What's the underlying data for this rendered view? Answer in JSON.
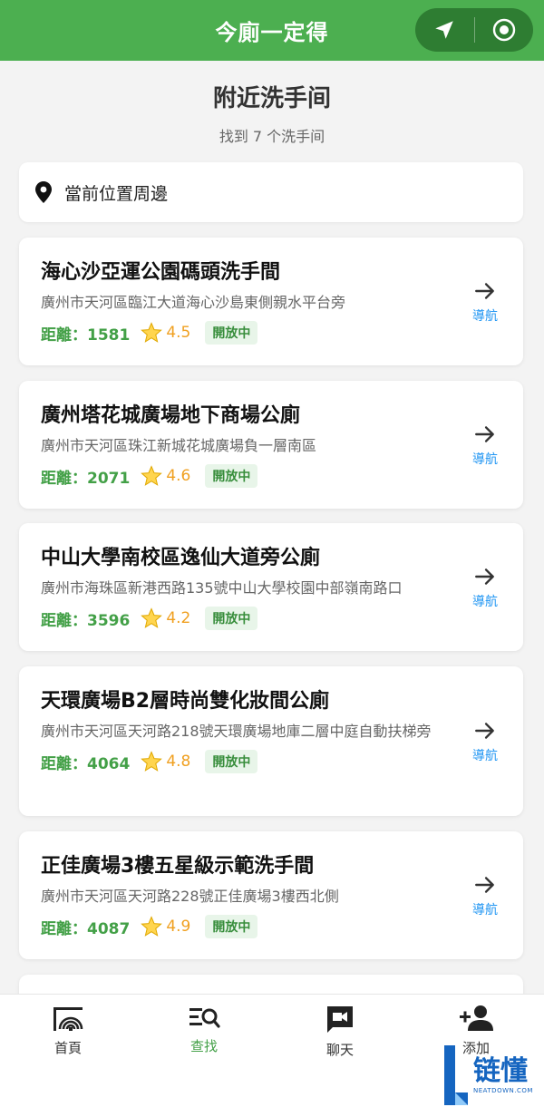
{
  "header": {
    "title": "今廁一定得",
    "capsule_left_icon": "navigation-arrow-icon",
    "capsule_right_icon": "target-circle-icon"
  },
  "page": {
    "title": "附近洗手间",
    "subtitle": "找到 7 个洗手间"
  },
  "location": {
    "icon": "location-pin-icon",
    "label": "當前位置周邊"
  },
  "toilets": [
    {
      "name": "海心沙亞運公園碼頭洗手間",
      "address": "廣州市天河區臨江大道海心沙島東側親水平台旁",
      "distance": "距離：1581",
      "rating": "4.5",
      "status": "開放中",
      "nav_label": "導航"
    },
    {
      "name": "廣州塔花城廣場地下商場公廁",
      "address": "廣州市天河區珠江新城花城廣場負一層南區",
      "distance": "距離：2071",
      "rating": "4.6",
      "status": "開放中",
      "nav_label": "導航"
    },
    {
      "name": "中山大學南校區逸仙大道旁公廁",
      "address": "廣州市海珠區新港西路135號中山大學校園中部嶺南路口",
      "distance": "距離：3596",
      "rating": "4.2",
      "status": "開放中",
      "nav_label": "導航"
    },
    {
      "name": "天環廣場B2層時尚雙化妝間公廁",
      "address": "廣州市天河區天河路218號天環廣場地庫二層中庭自動扶梯旁",
      "distance": "距離：4064",
      "rating": "4.8",
      "status": "開放中",
      "nav_label": "導航"
    },
    {
      "name": "正佳廣場3樓五星級示範洗手間",
      "address": "廣州市天河區天河路228號正佳廣場3樓西北側",
      "distance": "距離：4087",
      "rating": "4.9",
      "status": "開放中",
      "nav_label": "導航"
    }
  ],
  "tabbar": {
    "items": [
      {
        "label": "首頁",
        "icon": "toilet-signal-icon",
        "active": false
      },
      {
        "label": "查找",
        "icon": "search-list-icon",
        "active": true
      },
      {
        "label": "聊天",
        "icon": "video-chat-icon",
        "active": false
      },
      {
        "label": "添加",
        "icon": "add-person-icon",
        "active": false
      }
    ]
  },
  "watermark": {
    "main": "链懂",
    "sub": "NEATDOWN.COM"
  },
  "colors": {
    "primary_green": "#4caf50",
    "capsule_green": "#2e7d32",
    "distance_green": "#43a047",
    "star_orange": "#f0a020",
    "nav_blue": "#2196f3"
  }
}
